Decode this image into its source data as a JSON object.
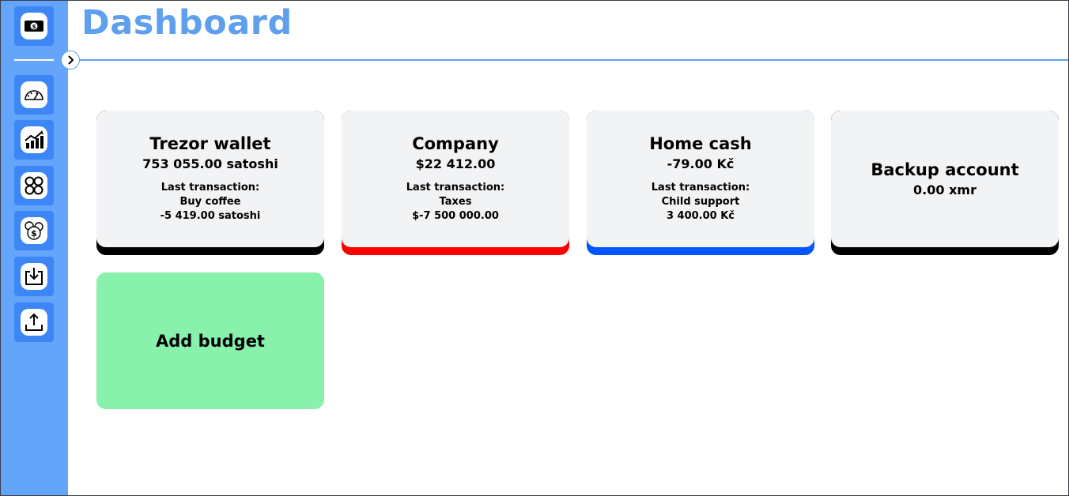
{
  "header": {
    "title": "Dashboard"
  },
  "sidebar": {
    "items": [
      {
        "name": "logo-cash-icon"
      },
      {
        "name": "dashboard-gauge-icon"
      },
      {
        "name": "stats-chart-icon"
      },
      {
        "name": "categories-grid-icon"
      },
      {
        "name": "currencies-icon"
      },
      {
        "name": "import-icon"
      },
      {
        "name": "export-icon"
      }
    ]
  },
  "budgets": [
    {
      "name": "Trezor wallet",
      "balance": "753 055.00 satoshi",
      "tx_label": "Last transaction:",
      "tx_title": "Buy coffee",
      "tx_amount": "-5 419.00 satoshi",
      "color": "#000000"
    },
    {
      "name": "Company",
      "balance": "$22 412.00",
      "tx_label": "Last transaction:",
      "tx_title": "Taxes",
      "tx_amount": "$-7 500 000.00",
      "color": "#ff0000"
    },
    {
      "name": "Home cash",
      "balance": "-79.00 Kč",
      "tx_label": "Last transaction:",
      "tx_title": "Child support",
      "tx_amount": "3 400.00 Kč",
      "color": "#0055ff"
    },
    {
      "name": "Backup account",
      "balance": "0.00 xmr",
      "color": "#000000"
    }
  ],
  "add_budget": {
    "label": "Add budget"
  },
  "colors": {
    "sidebar": "#64a4fb",
    "accent": "#5ea0ee",
    "add_card": "#88f2ad",
    "card_face": "#f2f3f5"
  }
}
